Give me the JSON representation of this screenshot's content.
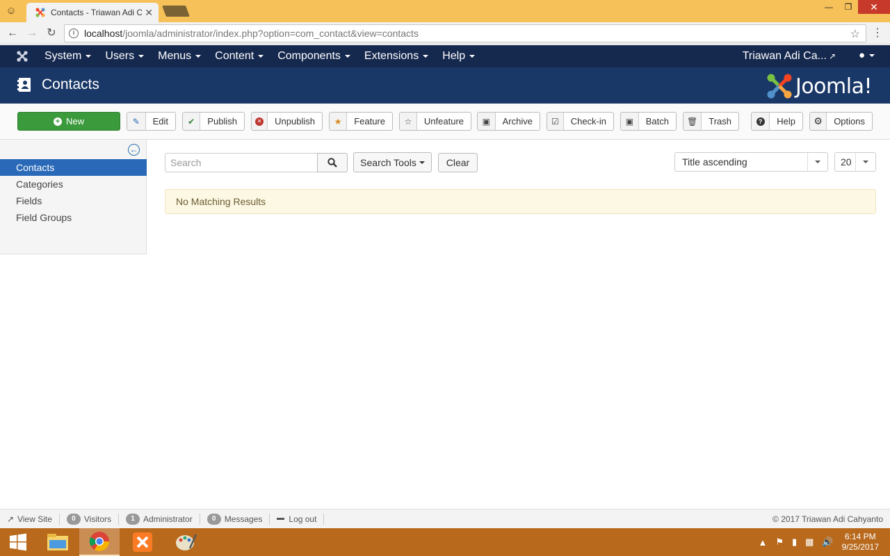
{
  "browser": {
    "tab_title": "Contacts - Triawan Adi C",
    "url_host": "localhost",
    "url_path": "/joomla/administrator/index.php?option=com_contact&view=contacts"
  },
  "navbar": {
    "menus": [
      "System",
      "Users",
      "Menus",
      "Content",
      "Components",
      "Extensions",
      "Help"
    ],
    "user_name": "Triawan Adi Ca..."
  },
  "header": {
    "title": "Contacts",
    "logo_text": "Joomla!"
  },
  "toolbar": {
    "new": "New",
    "edit": "Edit",
    "publish": "Publish",
    "unpublish": "Unpublish",
    "feature": "Feature",
    "unfeature": "Unfeature",
    "archive": "Archive",
    "checkin": "Check-in",
    "batch": "Batch",
    "trash": "Trash",
    "help": "Help",
    "options": "Options"
  },
  "sidebar": {
    "items": [
      {
        "label": "Contacts",
        "active": true
      },
      {
        "label": "Categories",
        "active": false
      },
      {
        "label": "Fields",
        "active": false
      },
      {
        "label": "Field Groups",
        "active": false
      }
    ]
  },
  "filters": {
    "search_placeholder": "Search",
    "search_tools": "Search Tools",
    "clear": "Clear",
    "sort": "Title ascending",
    "limit": "20"
  },
  "results": {
    "message": "No Matching Results"
  },
  "status": {
    "view_site": "View Site",
    "visitors_count": "0",
    "visitors_label": "Visitors",
    "admin_count": "1",
    "admin_label": "Administrator",
    "messages_count": "0",
    "messages_label": "Messages",
    "logout": "Log out",
    "copyright": "© 2017 Triawan Adi Cahyanto"
  },
  "taskbar": {
    "time": "6:14 PM",
    "date": "9/25/2017"
  },
  "colors": {
    "navbar": "#15294f",
    "header": "#1a3867",
    "new_button": "#3b9a3b",
    "sidebar_active": "#2a69b8",
    "alert_bg": "#fcf8e3",
    "taskbar": "#b8691c",
    "chrome_frame": "#f7c15a"
  }
}
